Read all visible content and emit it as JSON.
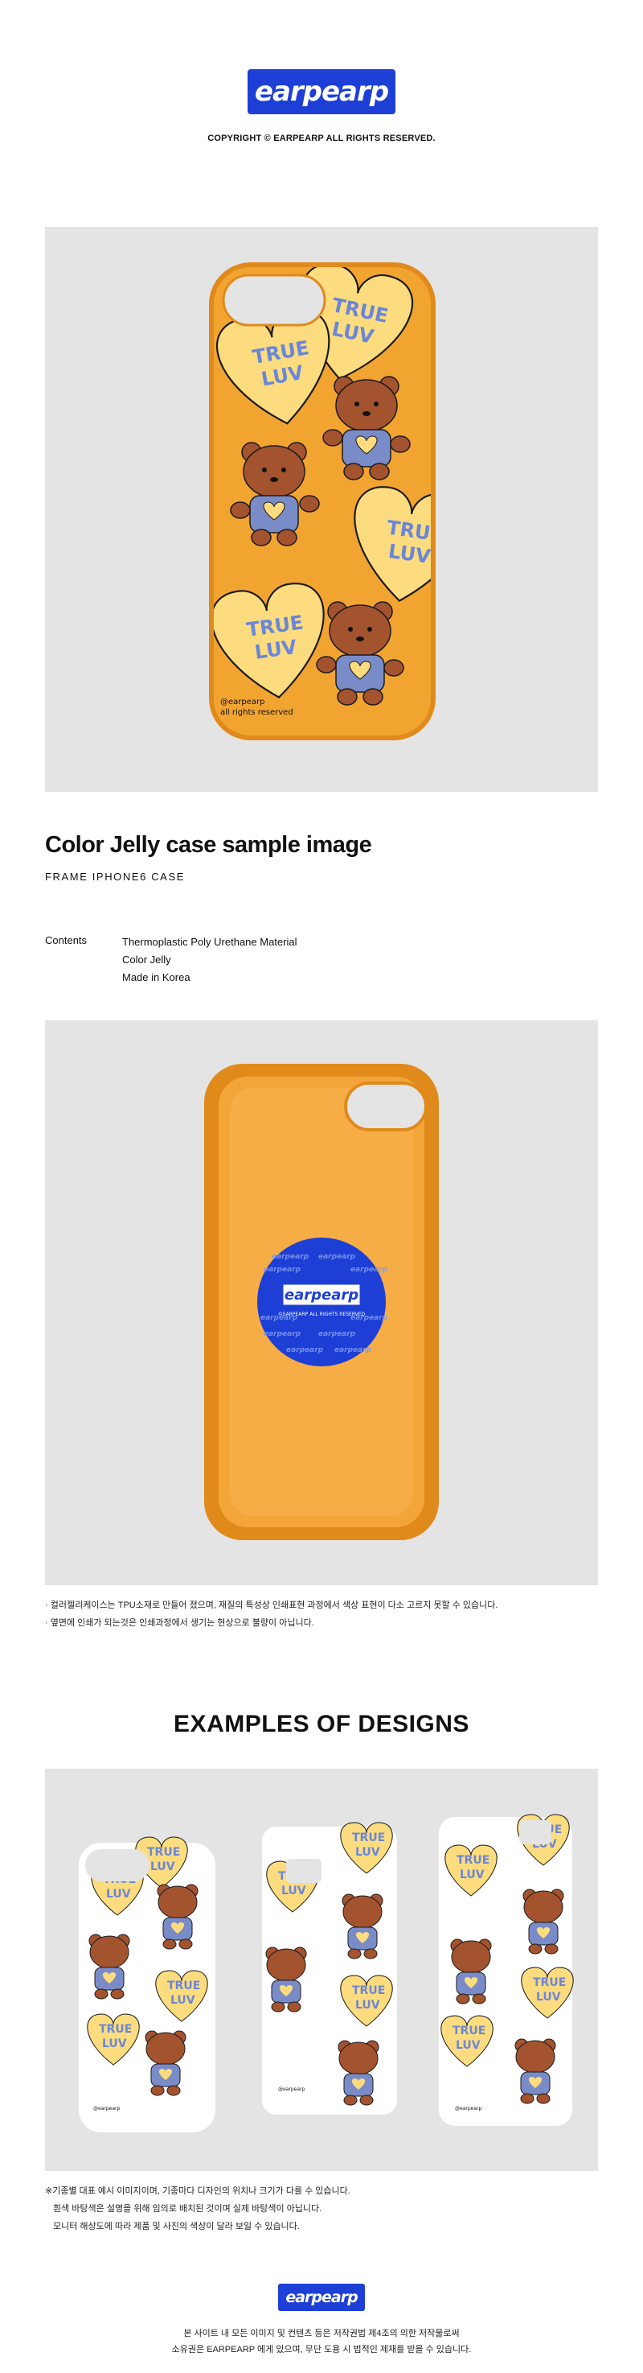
{
  "brand": {
    "logo_text": "earpearp",
    "copyright": "COPYRIGHT © EARPEARP ALL RIGHTS RESERVED."
  },
  "hero": {
    "case_text_lines": [
      "@earpearp",
      "all rights reserved"
    ],
    "heart_text": [
      "TRUE",
      "LUV"
    ]
  },
  "product": {
    "title": "Color Jelly case sample image",
    "subtitle": "FRAME IPHONE6 CASE",
    "contents_label": "Contents",
    "contents": [
      "Thermoplastic Poly Urethane Material",
      "Color Jelly",
      "Made in Korea"
    ]
  },
  "inside": {
    "sticker_logo": "earpearp",
    "sticker_text": "©EARPEARP ALL RIGHTS RESERVED"
  },
  "notes": [
    "· 컬러젤리케이스는 TPU소재로 만들어 졌으며, 재질의 특성상 인쇄표현 과정에서 색상 표현이 다소 고르지 못할 수 있습니다.",
    "· 옆면에 인쇄가 되는것은 인쇄과정에서 생기는 현상으로 불량이 아닙니다."
  ],
  "examples": {
    "title": "EXAMPLES OF DESIGNS",
    "notes": [
      "※기종별 대표 예시 이미지이며, 기종마다 디자인의 위치나 크기가 다를 수 있습니다.",
      "흰색 바탕색은 설명을 위해 임의로 배치된 것이며 실제 바탕색이 아닙니다.",
      "모니터 해상도에 따라 제품 및 사진의 색상이 달라 보일 수 있습니다."
    ]
  },
  "footer": {
    "lines": [
      "본 사이트 내 모든 이미지 및 컨텐츠 등은 저작권법 제4조의 의한 저작물로써",
      "소유권은 EARPEARP 에게 있으며, 무단 도용 시 법적인 제재를 받을 수 있습니다."
    ]
  },
  "colors": {
    "brand_blue": "#1d3fd6",
    "case_orange": "#f2a431",
    "heart_yellow": "#fcdc7e",
    "bear_brown": "#a4532f",
    "shirt_blue": "#7a8cc8",
    "panel_gray": "#e4e4e4"
  }
}
